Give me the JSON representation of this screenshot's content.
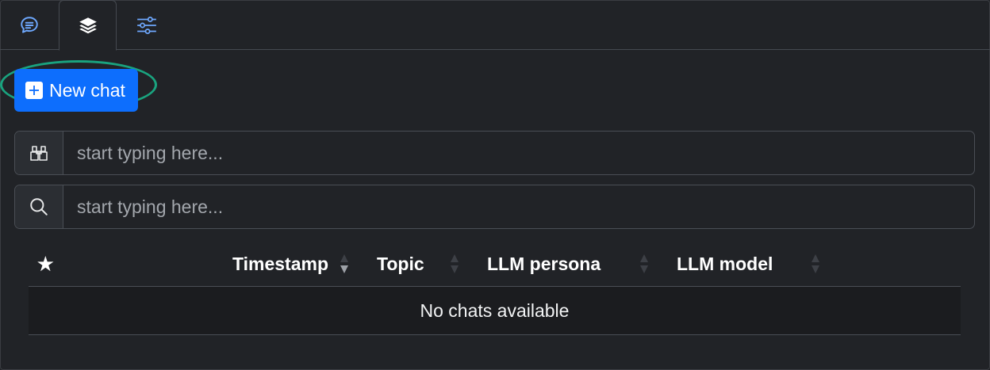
{
  "tabs": [
    {
      "icon": "chat-bubble-icon"
    },
    {
      "icon": "layers-icon",
      "active": true
    },
    {
      "icon": "sliders-icon"
    }
  ],
  "new_chat": {
    "label": "New chat",
    "icon": "plus-square-icon"
  },
  "filters": [
    {
      "icon": "binoculars-icon",
      "placeholder": "start typing here..."
    },
    {
      "icon": "search-icon",
      "placeholder": "start typing here..."
    }
  ],
  "table": {
    "star": "★",
    "columns": [
      "Timestamp",
      "Topic",
      "LLM persona",
      "LLM model"
    ],
    "empty_message": "No chats available"
  },
  "colors": {
    "accent": "#0d6efd",
    "highlight_ring": "#1aa37f",
    "background": "#212327"
  }
}
